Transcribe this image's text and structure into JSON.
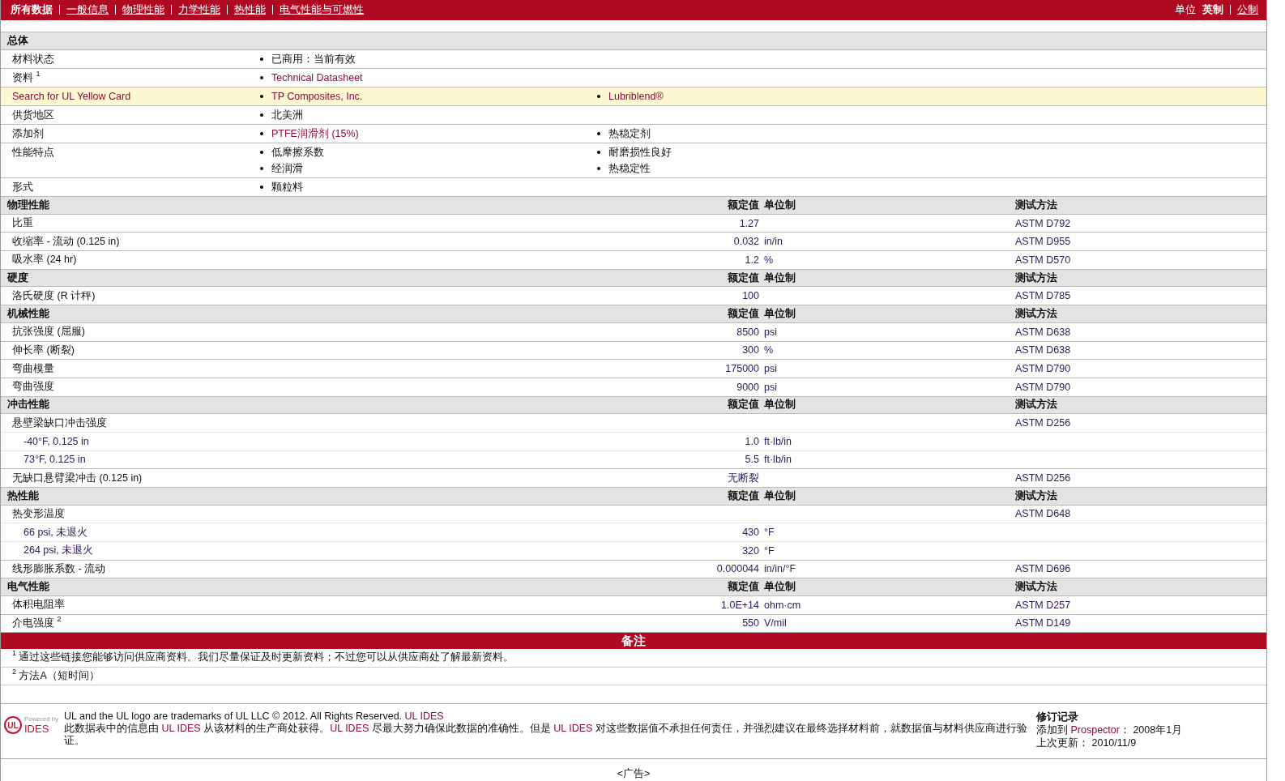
{
  "nav": {
    "tabs": [
      {
        "label": "所有数据",
        "selected": true
      },
      {
        "label": "一般信息",
        "selected": false
      },
      {
        "label": "物理性能",
        "selected": false
      },
      {
        "label": "力学性能",
        "selected": false
      },
      {
        "label": "热性能",
        "selected": false
      },
      {
        "label": "电气性能与可燃性",
        "selected": false
      }
    ],
    "units": {
      "label": "单位",
      "options": [
        {
          "label": "英制",
          "selected": true
        },
        {
          "label": "公制",
          "selected": false
        }
      ]
    }
  },
  "general": {
    "title": "总体",
    "rows": [
      {
        "label": "材料状态",
        "highlighted": false,
        "col_2": [
          {
            "text": "已商用：当前有效",
            "link": false
          }
        ],
        "col_3": []
      },
      {
        "label": "资料 $^{1}$",
        "highlighted": false,
        "col_2": [
          {
            "text": "Technical Datasheet",
            "link": true
          }
        ],
        "col_3": []
      },
      {
        "label": "Search for UL Yellow Card",
        "highlighted": true,
        "col_2": [
          {
            "text": "TP Composites, Inc.",
            "link": true
          }
        ],
        "col_3": [
          {
            "text": "Lubriblend®",
            "link": true
          }
        ]
      },
      {
        "label": "供货地区",
        "highlighted": false,
        "col_2": [
          {
            "text": "北美洲",
            "link": false
          }
        ],
        "col_3": []
      },
      {
        "label": "添加剂",
        "highlighted": false,
        "col_2": [
          {
            "text": "PTFE润滑剂 (15%)",
            "link": true
          }
        ],
        "col_3": [
          {
            "text": "热稳定剂",
            "link": false
          }
        ]
      },
      {
        "label": "性能特点",
        "highlighted": false,
        "col_2": [
          {
            "text": "低摩擦系数",
            "link": false
          },
          {
            "text": "经润滑",
            "link": false
          }
        ],
        "col_3": [
          {
            "text": "耐磨损性良好",
            "link": false
          },
          {
            "text": "热稳定性",
            "link": false
          }
        ]
      },
      {
        "label": "形式",
        "highlighted": false,
        "col_2": [
          {
            "text": "颗粒料",
            "link": false
          }
        ],
        "col_3": []
      }
    ]
  },
  "sections": [
    {
      "title": "物理性能",
      "value_head": "额定值",
      "unit_head": "单位制",
      "method_head": "测试方法",
      "rows": [
        {
          "label": "比重",
          "value": "1.27",
          "method": "ASTM D792",
          "indented": false
        },
        {
          "label": "收缩率 - 流动 (0.125 in)",
          "value": "0.032",
          "unit": "in/in",
          "method": "ASTM D955",
          "indented": false
        },
        {
          "label": "吸水率 (24 hr)",
          "value": "1.2",
          "unit": "%",
          "method": "ASTM D570",
          "indented": false
        }
      ]
    },
    {
      "title": "硬度",
      "value_head": "额定值",
      "unit_head": "单位制",
      "method_head": "测试方法",
      "rows": [
        {
          "label": "洛氏硬度 (R 计秤)",
          "value": "100",
          "method": "ASTM D785",
          "indented": false
        }
      ]
    },
    {
      "title": "机械性能",
      "value_head": "额定值",
      "unit_head": "单位制",
      "method_head": "测试方法",
      "rows": [
        {
          "label": "抗张强度 (屈服)",
          "value": "8500",
          "unit": "psi",
          "method": "ASTM D638",
          "indented": false
        },
        {
          "label": "伸长率 (断裂)",
          "value": "300",
          "unit": "%",
          "method": "ASTM D638",
          "indented": false
        },
        {
          "label": "弯曲模量",
          "value": "175000",
          "unit": "psi",
          "method": "ASTM D790",
          "indented": false
        },
        {
          "label": "弯曲强度",
          "value": "9000",
          "unit": "psi",
          "method": "ASTM D790",
          "indented": false
        }
      ]
    },
    {
      "title": "冲击性能",
      "value_head": "额定值",
      "unit_head": "单位制",
      "method_head": "测试方法",
      "rows": [
        {
          "label": "悬壁梁缺口冲击强度",
          "method": "ASTM D256",
          "indented": false
        },
        {
          "label": "-40°F, 0.125 in",
          "value": "1.0",
          "unit": "ft·lb/in",
          "indented": true
        },
        {
          "label": "73°F, 0.125 in",
          "value": "5.5",
          "unit": "ft·lb/in",
          "indented": true
        },
        {
          "label": "无缺口悬臂梁冲击 (0.125 in)",
          "value": "无断裂",
          "method": "ASTM D256",
          "indented": false
        }
      ]
    },
    {
      "title": "热性能",
      "value_head": "额定值",
      "unit_head": "单位制",
      "method_head": "测试方法",
      "rows": [
        {
          "label": "热变形温度",
          "method": "ASTM D648",
          "indented": false
        },
        {
          "label": "66 psi, 未退火",
          "value": "430",
          "unit": "°F",
          "indented": true
        },
        {
          "label": "264 psi, 未退火",
          "value": "320",
          "unit": "°F",
          "indented": true
        },
        {
          "label": "线形膨胀系数 - 流动",
          "value": "0.000044",
          "unit": "in/in/°F",
          "method": "ASTM D696",
          "indented": false
        }
      ]
    },
    {
      "title": "电气性能",
      "value_head": "额定值",
      "unit_head": "单位制",
      "method_head": "测试方法",
      "rows": [
        {
          "label": "体积电阻率",
          "value": "1.0E+14",
          "unit": "ohm·cm",
          "method": "ASTM D257",
          "indented": false
        },
        {
          "label": "介电强度 $^{2}$",
          "value": "550",
          "unit": "V/mil",
          "method": "ASTM D149",
          "indented": false
        }
      ]
    }
  ],
  "notes": {
    "title": "备注",
    "items": [
      "$^{1}$ 通过这些链接您能够访问供应商资料。我们尽量保证及时更新资料；不过您可以从供应商处了解最新资料。",
      "$^{2}$ 方法A（短时间）"
    ]
  },
  "footer": {
    "logo": {
      "mark": "UL",
      "caption": "Powered by",
      "name": "IDES"
    },
    "trademark": [
      {
        "kind": "text",
        "text": "UL and the UL logo are trademarks of UL LLC © 2012. All Rights Reserved. "
      },
      {
        "kind": "link",
        "text": "UL IDES"
      }
    ],
    "disclaimer": [
      {
        "kind": "text",
        "text": "此数据表中的信息由 "
      },
      {
        "kind": "link",
        "text": "UL IDES"
      },
      {
        "kind": "text",
        "text": " 从该材料的生产商处获得。"
      },
      {
        "kind": "link",
        "text": "UL IDES"
      },
      {
        "kind": "text",
        "text": " 尽最大努力确保此数据的准确性。但是 "
      },
      {
        "kind": "link",
        "text": "UL IDES"
      },
      {
        "kind": "text",
        "text": " 对这些数据值不承担任何责任，并强烈建议在最终选择材料前，就数据值与材料供应商进行验证。"
      }
    ],
    "revision": {
      "title": "修订记录",
      "lines": [
        [
          {
            "kind": "text",
            "text": "添加到 "
          },
          {
            "kind": "link",
            "text": "Prospector"
          },
          {
            "kind": "text",
            "text": "：  2008年1月"
          }
        ],
        [
          {
            "kind": "text",
            "text": "上次更新：  2010/11/9"
          }
        ]
      ]
    }
  },
  "ad": "<广告>"
}
